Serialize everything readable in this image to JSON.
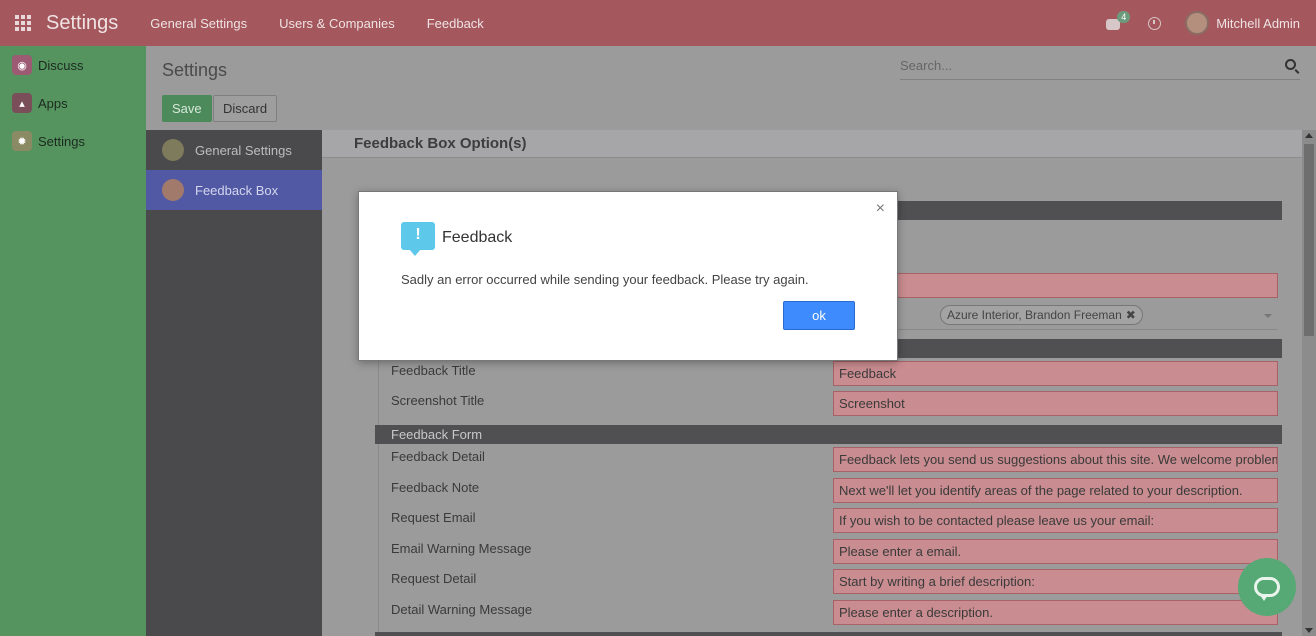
{
  "navbar": {
    "brand": "Settings",
    "menu": [
      "General Settings",
      "Users & Companies",
      "Feedback"
    ],
    "messages_badge": "4",
    "user_name": "Mitchell Admin"
  },
  "sidebar": {
    "items": [
      {
        "label": "Discuss",
        "icon": "discuss-icon"
      },
      {
        "label": "Apps",
        "icon": "apps-icon"
      },
      {
        "label": "Settings",
        "icon": "settings-icon"
      }
    ]
  },
  "main": {
    "title": "Settings",
    "search_placeholder": "Search...",
    "save_label": "Save",
    "discard_label": "Discard"
  },
  "settings_nav": {
    "items": [
      {
        "label": "General Settings",
        "active": false
      },
      {
        "label": "Feedback Box",
        "active": true
      }
    ]
  },
  "content": {
    "section_title": "Feedback Box Option(s)",
    "tags": [
      "erior",
      "Azure Interior, Brandon Freeman"
    ],
    "fields": [
      {
        "label": "Feedback Title",
        "value": "Feedback"
      },
      {
        "label": "Screenshot Title",
        "value": "Screenshot"
      }
    ],
    "form_band": "Feedback Form",
    "form_fields": [
      {
        "label": "Feedback Detail",
        "value": "Feedback lets you send us suggestions about this site. We welcome problem"
      },
      {
        "label": "Feedback Note",
        "value": "Next we'll let you identify areas of the page related to your description."
      },
      {
        "label": "Request Email",
        "value": "If you wish to be contacted please leave us your email:"
      },
      {
        "label": "Email Warning Message",
        "value": "Please enter a email."
      },
      {
        "label": "Request Detail",
        "value": "Start by writing a brief description:"
      },
      {
        "label": "Detail Warning Message",
        "value": "Please enter a description."
      }
    ]
  },
  "modal": {
    "title": "Feedback",
    "message": "Sadly an error occurred while sending your feedback. Please try again.",
    "ok_label": "ok",
    "close_glyph": "×",
    "icon_glyph": "!"
  },
  "colors": {
    "navbar": "#a4575c",
    "sidebar": "#55945f",
    "accent_blue": "#3d8bfd",
    "active_nav": "#5159a4"
  }
}
